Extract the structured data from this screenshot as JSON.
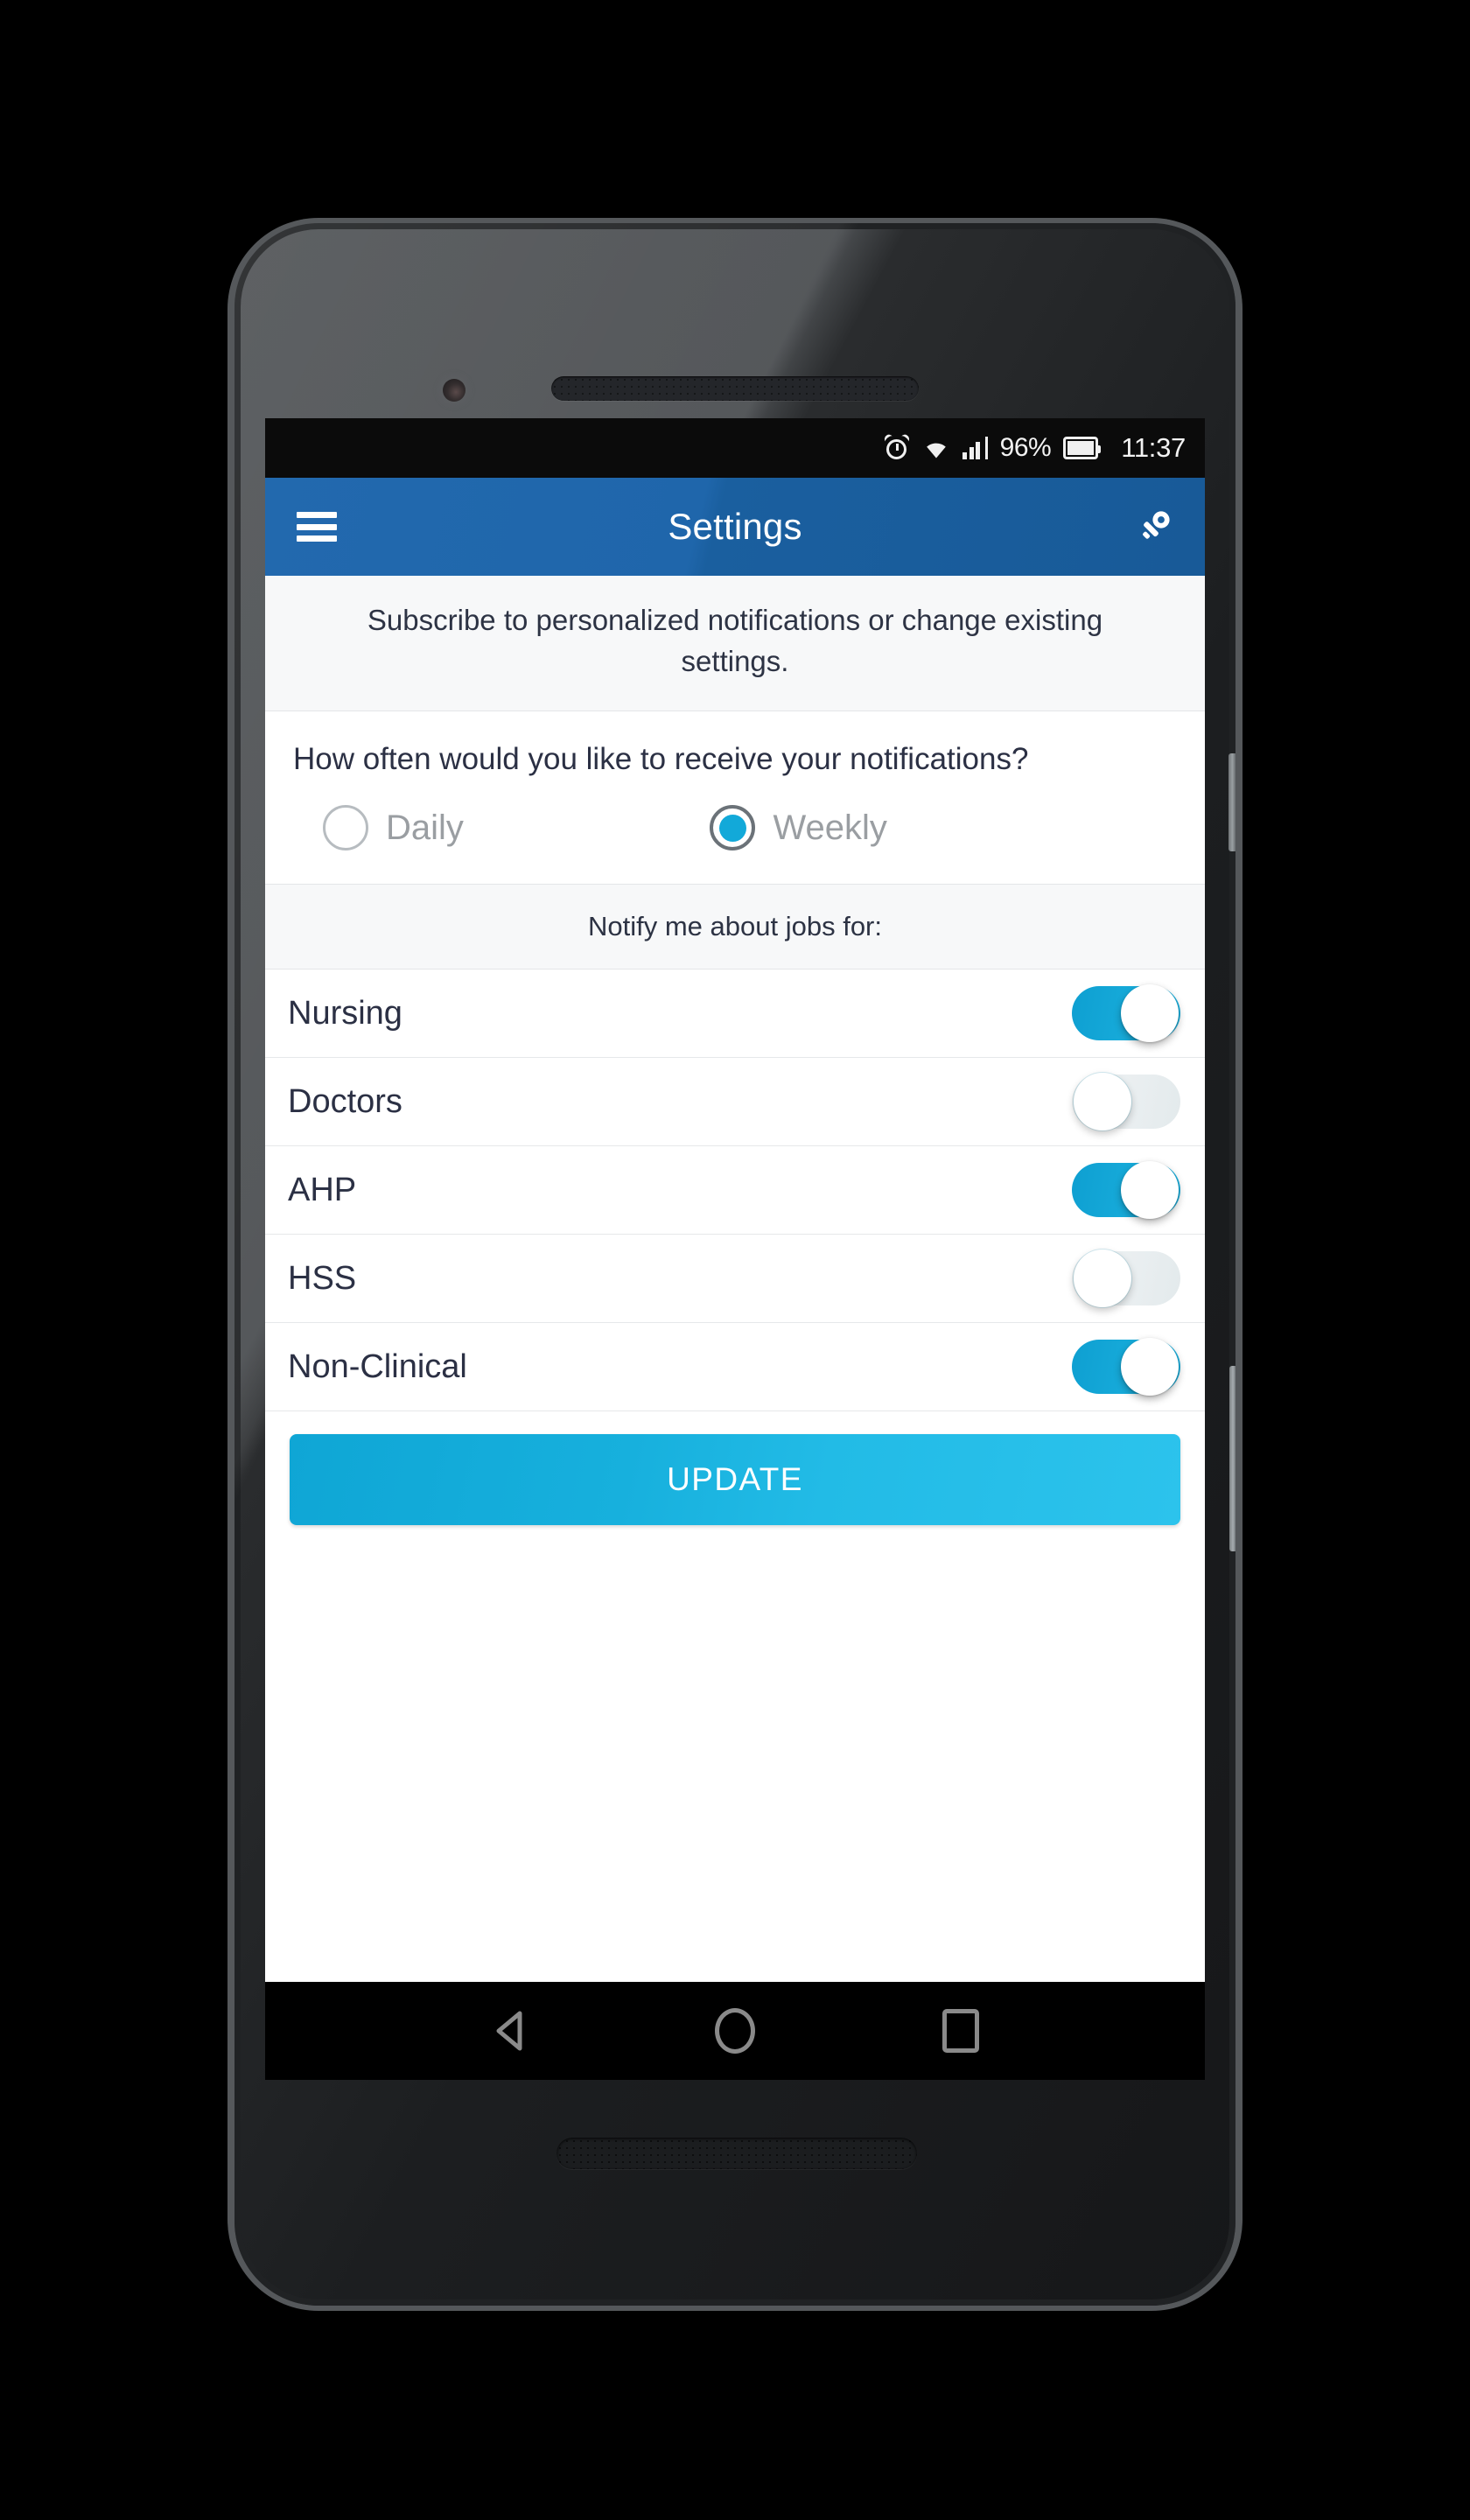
{
  "statusbar": {
    "alarm_icon": "alarm-icon",
    "wifi_icon": "wifi-icon",
    "signal_icon": "signal-bars-icon",
    "battery_percent": "96%",
    "battery_icon": "battery-icon",
    "time": "11:37"
  },
  "appbar": {
    "menu_icon": "hamburger-menu-icon",
    "title": "Settings",
    "action_icon": "key-icon"
  },
  "note": {
    "text": "Subscribe to personalized notifications or change existing settings."
  },
  "frequency": {
    "question": "How often would you like to receive your notifications?",
    "options": [
      {
        "label": "Daily",
        "selected": false
      },
      {
        "label": "Weekly",
        "selected": true
      }
    ]
  },
  "jobs": {
    "header": "Notify me about jobs for:",
    "items": [
      {
        "label": "Nursing",
        "enabled": true
      },
      {
        "label": "Doctors",
        "enabled": false
      },
      {
        "label": "AHP",
        "enabled": true
      },
      {
        "label": "HSS",
        "enabled": false
      },
      {
        "label": "Non-Clinical",
        "enabled": true
      }
    ]
  },
  "actions": {
    "update_label": "UPDATE"
  },
  "navbar": {
    "back_icon": "back-triangle-icon",
    "home_icon": "home-circle-icon",
    "recents_icon": "recents-square-icon"
  },
  "colors": {
    "appbar_blue": "#1f66ab",
    "accent_cyan": "#17abda",
    "text_dark": "#2b3044",
    "text_muted": "#9a9ea2",
    "panel_gray": "#f7f8f9"
  }
}
